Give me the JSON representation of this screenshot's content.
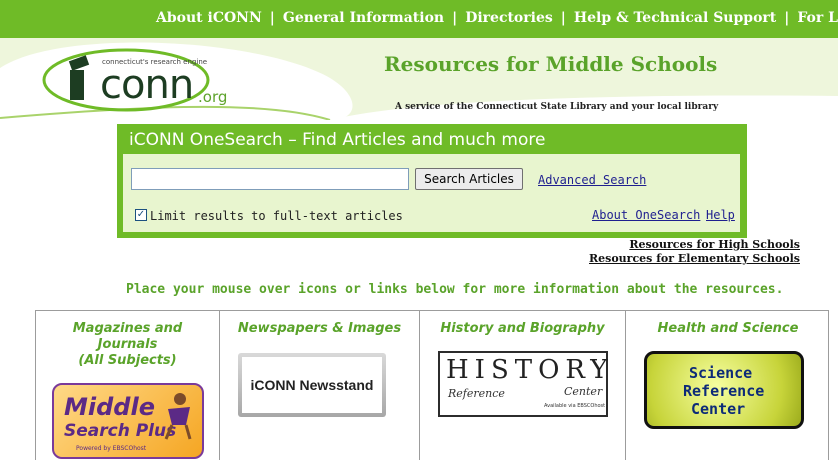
{
  "nav": {
    "items": [
      "About iCONN",
      "General Information",
      "Directories",
      "Help & Technical Support",
      "For Librarians"
    ],
    "separator": "|"
  },
  "header": {
    "logo_tagline": "connecticut's research engine",
    "logo_word": "conn",
    "logo_suffix": ".org",
    "title": "Resources for Middle Schools",
    "subtitle": "A service of the Connecticut State Library and your local library"
  },
  "search": {
    "title": "iCONN OneSearch – Find Articles and much more",
    "input_value": "",
    "button_label": "Search Articles",
    "advanced_link": "Advanced Search",
    "checkbox_label": "Limit results to full-text articles",
    "checkbox_checked": true,
    "about_link": "About OneSearch",
    "help_link": "Help"
  },
  "resource_links": [
    "Resources for High Schools",
    "Resources for Elementary Schools"
  ],
  "instruction": "Place your mouse over icons or links below for more information about the resources.",
  "columns": [
    {
      "heading": "Magazines and Journals (All Subjects)",
      "heading_lines": [
        "Magazines and",
        "Journals",
        "(All Subjects)"
      ],
      "badge_lines": [
        "Middle",
        "Search Plus",
        "Powered by EBSCOhost"
      ]
    },
    {
      "heading": "Newspapers & Images",
      "badge_text": "iCONN Newsstand"
    },
    {
      "heading": "History and Biography",
      "badge_lines": [
        "HISTORY",
        "Reference",
        "Center",
        "Available via EBSCOhost"
      ]
    },
    {
      "heading": "Health and Science",
      "badge_lines": [
        "Science",
        "Reference",
        "Center"
      ]
    }
  ],
  "colors": {
    "brand_green": "#6fbb27",
    "heading_green": "#5aa32a",
    "link_blue": "#1f1f8f"
  }
}
